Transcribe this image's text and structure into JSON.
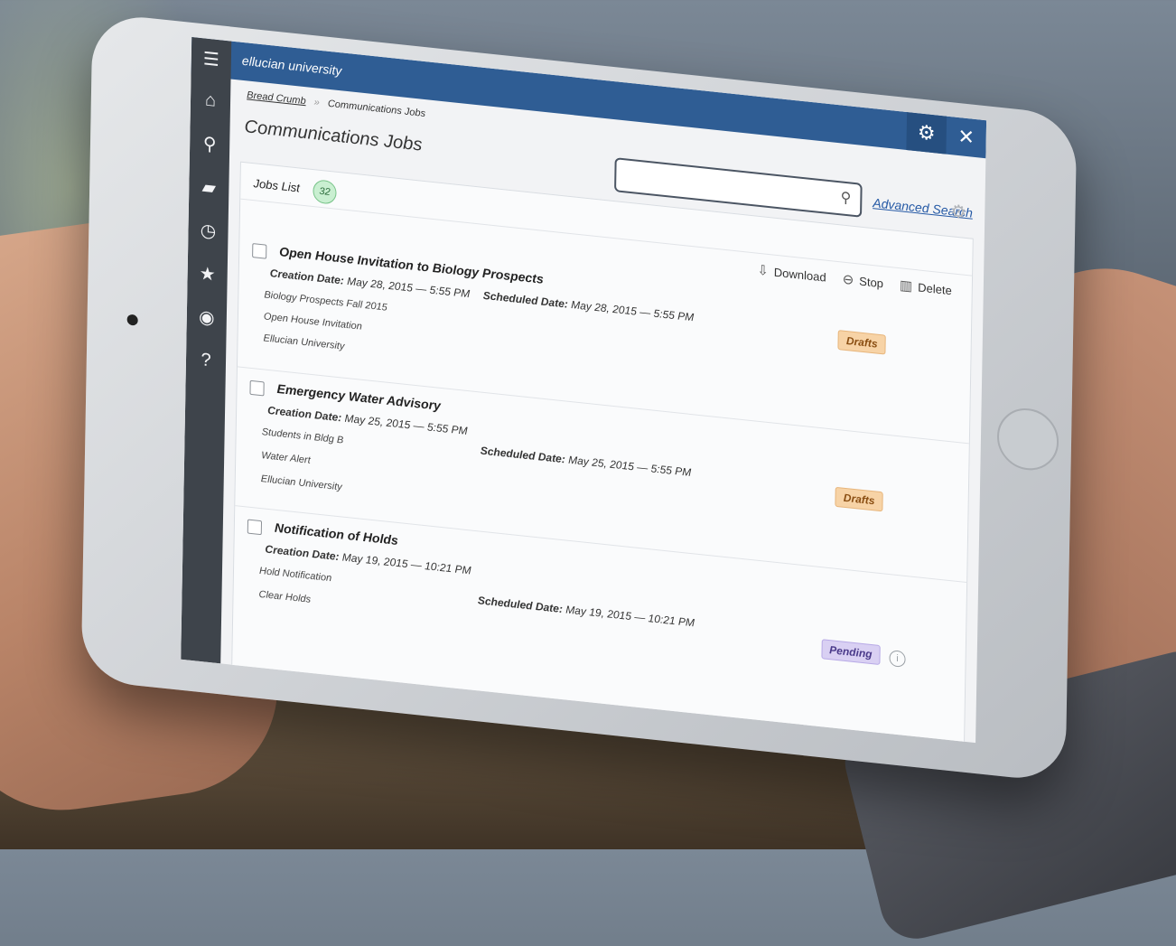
{
  "app": {
    "brand": "ellucian university"
  },
  "breadcrumb": {
    "link": "Bread Crumb",
    "separator": "»",
    "current": "Communications Jobs"
  },
  "page": {
    "title": "Communications Jobs"
  },
  "search": {
    "value": "",
    "placeholder": "",
    "advanced_label": "Advanced Search"
  },
  "list": {
    "title": "Jobs List",
    "count": "32"
  },
  "actions": {
    "download": "Download",
    "stop": "Stop",
    "delete": "Delete"
  },
  "icons": {
    "menu": "☰",
    "home": "⌂",
    "search": "⚲",
    "folder": "▰",
    "history": "◷",
    "star": "★",
    "user": "◉",
    "help": "?",
    "gear": "⚙",
    "close": "✕",
    "download": "⇩",
    "stop": "⊖",
    "delete": "▥",
    "info": "i"
  },
  "jobs": [
    {
      "title": "Open House Invitation to Biology Prospects",
      "creation_label": "Creation Date:",
      "creation_value": "May 28, 2015 — 5:55 PM",
      "scheduled_label": "Scheduled Date:",
      "scheduled_value": "May 28, 2015 — 5:55 PM",
      "lines": [
        "Biology Prospects Fall 2015",
        "Open House Invitation",
        "Ellucian University"
      ],
      "status": "Drafts"
    },
    {
      "title": "Emergency Water Advisory",
      "creation_label": "Creation Date:",
      "creation_value": "May 25, 2015 — 5:55 PM",
      "scheduled_label": "Scheduled Date:",
      "scheduled_value": "May 25, 2015 — 5:55 PM",
      "lines": [
        "Students in Bldg B",
        "Water Alert",
        "Ellucian University"
      ],
      "status": "Drafts"
    },
    {
      "title": "Notification of Holds",
      "creation_label": "Creation Date:",
      "creation_value": "May 19, 2015 — 10:21 PM",
      "scheduled_label": "Scheduled Date:",
      "scheduled_value": "May 19, 2015 — 10:21 PM",
      "lines": [
        "Hold Notification",
        "Clear Holds"
      ],
      "status": "Pending"
    }
  ],
  "colors": {
    "topbar": "#2f5d94",
    "sidebar": "#3e444b",
    "link": "#2559a5",
    "drafts": "#f7d3a6",
    "pending": "#d9d0f3"
  }
}
